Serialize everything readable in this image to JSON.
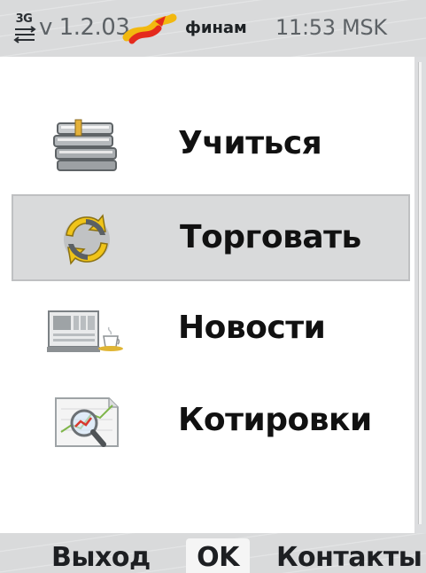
{
  "status_bar": {
    "network": "3G",
    "version": "v 1.2.03",
    "brand": "финам",
    "clock": "11:53 MSK"
  },
  "menu": {
    "selected_index": 1,
    "items": [
      {
        "label": "Учиться",
        "icon": "books-icon"
      },
      {
        "label": "Торговать",
        "icon": "trade-cycle-icon"
      },
      {
        "label": "Новости",
        "icon": "news-icon"
      },
      {
        "label": "Котировки",
        "icon": "quotes-magnifier-icon"
      }
    ]
  },
  "softkeys": {
    "left": "Выход",
    "center": "OK",
    "right": "Контакты"
  },
  "colors": {
    "background": "#d9dadb",
    "panel": "#ffffff",
    "selection": "#d9dadb",
    "logo_red": "#e42a1d",
    "logo_yellow": "#f2b80f"
  }
}
